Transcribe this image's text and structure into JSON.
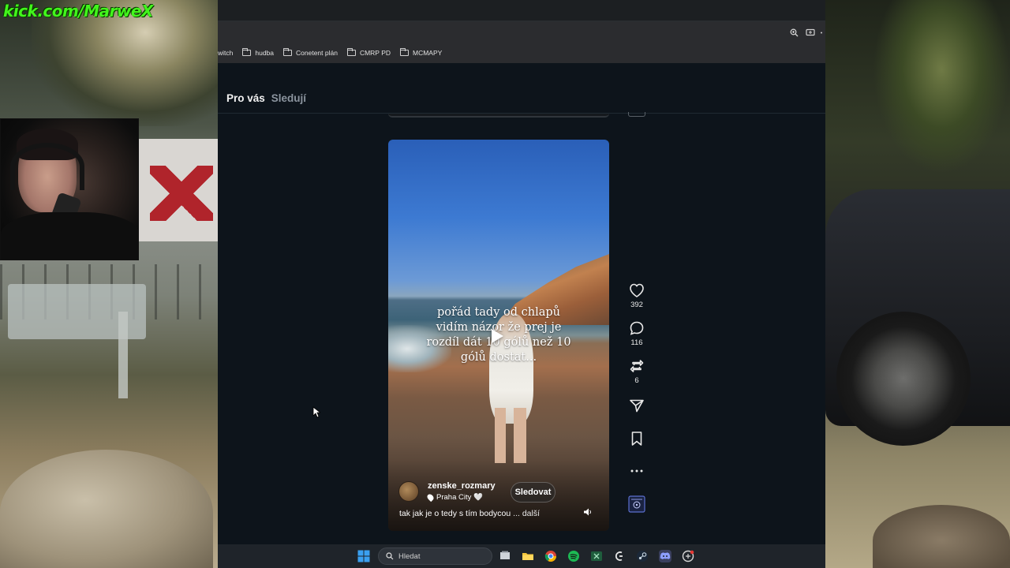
{
  "overlay": {
    "stream_link": "kick.com/MarweX"
  },
  "browser": {
    "bookmarks": [
      {
        "label": "witch",
        "folder": false
      },
      {
        "label": "hudba",
        "folder": true
      },
      {
        "label": "Conetent plán",
        "folder": true
      },
      {
        "label": "CMRP PD",
        "folder": true
      },
      {
        "label": "MCMAPY",
        "folder": true
      }
    ]
  },
  "feed": {
    "tabs": [
      {
        "label": "Pro vás",
        "active": true
      },
      {
        "label": "Sledují",
        "active": false
      }
    ]
  },
  "post": {
    "overlay_text": "pořád tady od chlapů vidím názor že prej je rozdíl dát 10 gólů než 10 gólů dostat...",
    "author": "zenske_rozmary",
    "location": "Praha City 🤍",
    "follow_label": "Sledovat",
    "description": "tak jak je o tedy s tím bodycou",
    "more_label": "... další",
    "actions": {
      "likes": "392",
      "replies": "116",
      "reposts": "6"
    }
  },
  "taskbar": {
    "search_placeholder": "Hledat",
    "colors": {
      "accent": "#3aa0f0"
    }
  },
  "colors": {
    "page_bg": "#0d141b",
    "stream_link": "#42f51c",
    "icon_fg": "#e8e8e8"
  }
}
